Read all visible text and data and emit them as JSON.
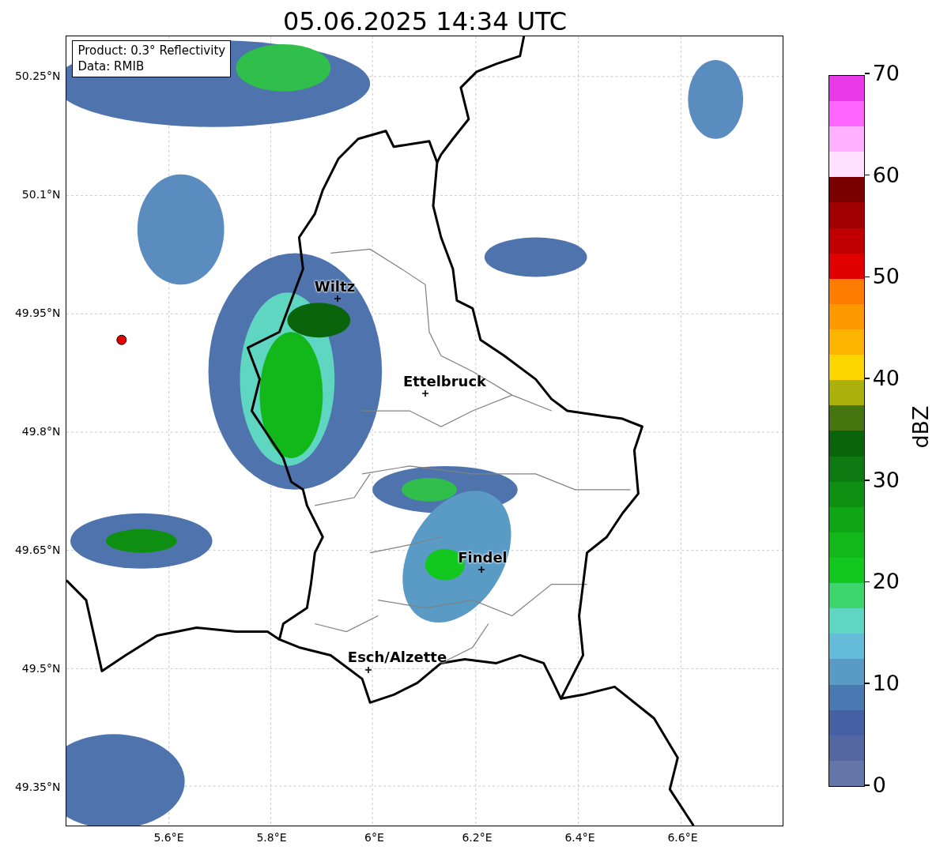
{
  "title": "05.06.2025 14:34 UTC",
  "info": [
    "Product: 0.3° Reflectivity",
    "Data: RMIB"
  ],
  "map": {
    "cities": [
      {
        "name": "Wiltz"
      },
      {
        "name": "Ettelbruck"
      },
      {
        "name": "Findel"
      },
      {
        "name": "Esch/Alzette"
      }
    ],
    "lat_ticks": [
      "50.25°N",
      "50.1°N",
      "49.95°N",
      "49.8°N",
      "49.65°N",
      "49.5°N",
      "49.35°N"
    ],
    "lon_ticks": [
      "5.6°E",
      "5.8°E",
      "6°E",
      "6.2°E",
      "6.4°E",
      "6.6°E"
    ]
  },
  "colorbar": {
    "label": "dBZ",
    "ticks": [
      "70",
      "60",
      "50",
      "40",
      "30",
      "20",
      "10",
      "0"
    ],
    "bins": [
      {
        "color": "#6577a8"
      },
      {
        "color": "#5467a0"
      },
      {
        "color": "#4561a3"
      },
      {
        "color": "#4a78b0"
      },
      {
        "color": "#5a9bc6"
      },
      {
        "color": "#63bdd9"
      },
      {
        "color": "#5fd6c2"
      },
      {
        "color": "#3dd66c"
      },
      {
        "color": "#12c81f"
      },
      {
        "color": "#12b81a"
      },
      {
        "color": "#10a514"
      },
      {
        "color": "#0e8f12"
      },
      {
        "color": "#0c7a10"
      },
      {
        "color": "#0a640c"
      },
      {
        "color": "#467510"
      },
      {
        "color": "#acb00a"
      },
      {
        "color": "#fdd500"
      },
      {
        "color": "#fdb500"
      },
      {
        "color": "#fe9a00"
      },
      {
        "color": "#fe7d00"
      },
      {
        "color": "#e00000"
      },
      {
        "color": "#c00000"
      },
      {
        "color": "#a00000"
      },
      {
        "color": "#7a0000"
      },
      {
        "color": "#ffe0ff"
      },
      {
        "color": "#ffb0ff"
      },
      {
        "color": "#ff66ff"
      },
      {
        "color": "#e83ae8"
      }
    ]
  }
}
